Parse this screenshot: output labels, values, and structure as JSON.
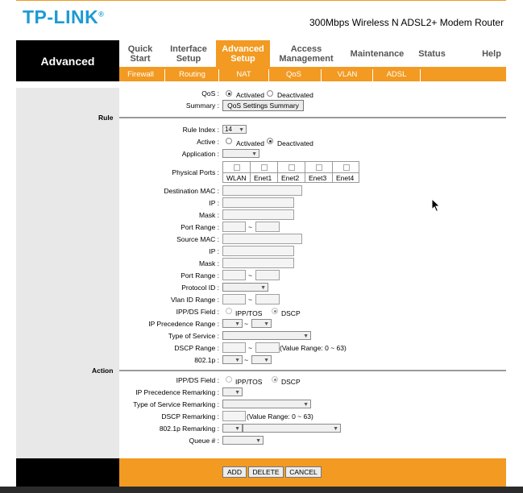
{
  "brand": {
    "logo": "TP-LINK",
    "trademark": "®",
    "model": "300Mbps Wireless N ADSL2+ Modem Router"
  },
  "left_title": "Advanced",
  "menu": [
    {
      "label": "Quick Start"
    },
    {
      "label": "Interface Setup"
    },
    {
      "label": "Advanced Setup",
      "active": true
    },
    {
      "label": "Access Management"
    },
    {
      "label": "Maintenance"
    },
    {
      "label": "Status"
    },
    {
      "label": "Help"
    }
  ],
  "submenu": [
    "Firewall",
    "Routing",
    "NAT",
    "QoS",
    "VLAN",
    "ADSL"
  ],
  "qos": {
    "label": "QoS :",
    "activated": "Activated",
    "deactivated": "Deactivated",
    "summary_label": "Summary :",
    "summary_button": "QoS Settings Summary"
  },
  "rule": {
    "section": "Rule",
    "rule_index_label": "Rule Index :",
    "rule_index_value": "14",
    "active_label": "Active :",
    "activated": "Activated",
    "deactivated": "Deactivated",
    "application_label": "Application :",
    "physical_ports_label": "Physical Ports :",
    "ports": [
      "WLAN",
      "Enet1",
      "Enet2",
      "Enet3",
      "Enet4"
    ],
    "dest_mac_label": "Destination MAC :",
    "ip_label": "IP :",
    "mask_label": "Mask :",
    "port_range_label": "Port Range :",
    "source_mac_label": "Source MAC :",
    "protocol_id_label": "Protocol ID :",
    "vlan_id_range_label": "Vlan ID Range :",
    "ipds_field_label": "IPP/DS Field :",
    "ipp_tos": "IPP/TOS",
    "dscp": "DSCP",
    "ip_precedence_range_label": "IP Precedence Range :",
    "type_of_service_label": "Type of Service :",
    "dscp_range_label": "DSCP Range :",
    "dscp_range_hint": "(Value Range: 0 ~ 63)",
    "p8021_label": "802.1p :",
    "tilde": "~"
  },
  "action": {
    "section": "Action",
    "ipds_field_label": "IPP/DS Field :",
    "ipp_tos": "IPP/TOS",
    "dscp": "DSCP",
    "ip_precedence_remarking_label": "IP Precedence Remarking :",
    "tos_remarking_label": "Type of Service Remarking :",
    "dscp_remarking_label": "DSCP Remarking :",
    "dscp_remarking_hint": "(Value Range: 0 ~ 63)",
    "p8021_remarking_label": "802.1p Remarking :",
    "queue_label": "Queue # :"
  },
  "buttons": {
    "add": "ADD",
    "delete": "DELETE",
    "cancel": "CANCEL"
  },
  "colors": {
    "orange": "#f29a22",
    "logo_blue": "#1c9bd4",
    "black": "#000000"
  }
}
